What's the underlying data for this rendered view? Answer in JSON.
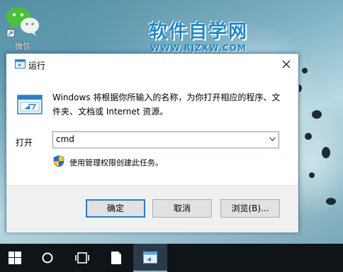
{
  "desktop": {
    "wechat_label": "微信",
    "watermark_title": "软件自学网",
    "watermark_sub": "WWW.RJZXW.COM"
  },
  "dialog": {
    "title": "运行",
    "description": "Windows 将根据你所输入的名称，为你打开相应的程序、文件夹、文档或 Internet 资源。",
    "open_label": "打开",
    "command_value": "cmd",
    "admin_note": "使用管理权限创建此任务。",
    "buttons": {
      "ok": "确定",
      "cancel": "取消",
      "browse": "浏览(B)..."
    }
  },
  "taskbar": {
    "items": [
      "windows-start",
      "search",
      "task-view",
      "file",
      "run"
    ]
  },
  "colors": {
    "accent": "#2b79d0",
    "taskbar": "#0f1418",
    "watermark": "#1e88c8"
  }
}
